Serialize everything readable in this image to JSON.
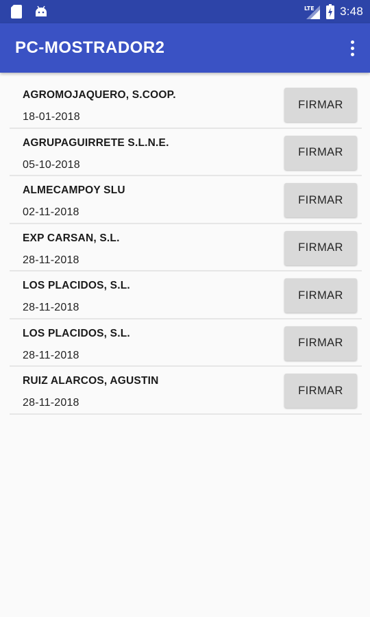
{
  "status_bar": {
    "time": "3:48",
    "network_label": "LTE",
    "left_icons": [
      "sd-card-icon",
      "android-icon"
    ],
    "right_icons": [
      "lte-signal-icon",
      "battery-charging-icon"
    ]
  },
  "app_bar": {
    "title": "PC-MOSTRADOR2",
    "menu_icon": "overflow-menu-icon"
  },
  "items": [
    {
      "name": "AGROMOJAQUERO, S.COOP.",
      "date": "18-01-2018",
      "button": "FIRMAR"
    },
    {
      "name": "AGRUPAGUIRRETE S.L.N.E.",
      "date": "05-10-2018",
      "button": "FIRMAR"
    },
    {
      "name": "ALMECAMPOY SLU",
      "date": "02-11-2018",
      "button": "FIRMAR"
    },
    {
      "name": "EXP CARSAN, S.L.",
      "date": "28-11-2018",
      "button": "FIRMAR"
    },
    {
      "name": "LOS PLACIDOS, S.L.",
      "date": "28-11-2018",
      "button": "FIRMAR"
    },
    {
      "name": "LOS PLACIDOS, S.L.",
      "date": "28-11-2018",
      "button": "FIRMAR"
    },
    {
      "name": "RUIZ ALARCOS, AGUSTIN",
      "date": "28-11-2018",
      "button": "FIRMAR"
    }
  ],
  "colors": {
    "status_bar": "#2d44a8",
    "app_bar": "#3a52c4",
    "background": "#fafafa",
    "button": "#d9d9d9"
  }
}
